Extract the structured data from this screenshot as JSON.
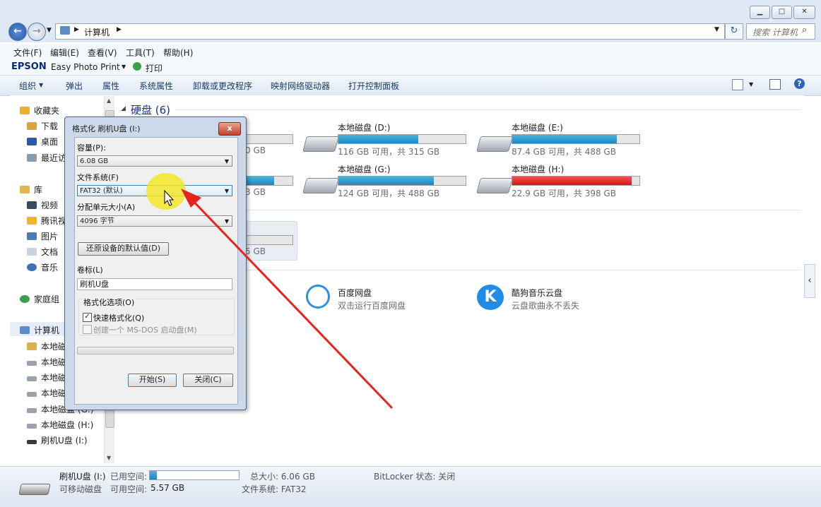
{
  "window": {
    "address": [
      "计算机"
    ],
    "search_placeholder": "搜索 计算机",
    "menu": [
      "文件(F)",
      "编辑(E)",
      "查看(V)",
      "工具(T)",
      "帮助(H)"
    ],
    "epson": {
      "brand": "EPSON",
      "app": "Easy Photo Print",
      "print": "打印"
    },
    "toolbar": [
      "组织",
      "弹出",
      "属性",
      "系统属性",
      "卸载或更改程序",
      "映射网络驱动器",
      "打开控制面板"
    ]
  },
  "nav": {
    "favorites": "收藏夹",
    "fav_items": [
      "下载",
      "桌面",
      "最近访"
    ],
    "libraries": "库",
    "lib_items": [
      "视频",
      "腾讯视",
      "图片",
      "文档",
      "音乐"
    ],
    "homegroup": "家庭组",
    "computer": "计算机",
    "drives": [
      "本地磁",
      "本地磁",
      "本地磁",
      "本地磁",
      "本地磁盘 (G:)",
      "本地磁盘 (H:)",
      "刷机U盘 (I:)"
    ]
  },
  "content": {
    "hdd_title": "硬盘 (6)",
    "drives": [
      {
        "name": "本地磁盘 (D:)",
        "info": "116 GB 可用，共 315 GB",
        "used": 0.63,
        "red": false
      },
      {
        "name": "本地磁盘 (E:)",
        "info": "87.4 GB 可用，共 488 GB",
        "used": 0.82,
        "red": false
      },
      {
        "name": "本地磁盘 (G:)",
        "info": "124 GB 可用，共 488 GB",
        "used": 0.75,
        "red": false
      },
      {
        "name": "本地磁盘 (H:)",
        "info": "22.9 GB 可用，共 398 GB",
        "used": 0.94,
        "red": true
      }
    ],
    "hidden_partial": [
      "0 GB",
      "3 GB",
      "5 GB"
    ],
    "apps": [
      {
        "name": "百度网盘",
        "desc": "双击运行百度网盘"
      },
      {
        "name": "酷狗音乐云盘",
        "desc": "云盘歌曲永不丢失"
      }
    ]
  },
  "status": {
    "name": "刷机U盘 (I:)",
    "type": "可移动磁盘",
    "used_label": "已用空间:",
    "free_label": "可用空间:",
    "free_value": "5.57 GB",
    "total": "总大小: 6.06 GB",
    "fs": "文件系统: FAT32",
    "bitlocker": "BitLocker 状态: 关闭",
    "used_fraction": 0.08
  },
  "dialog": {
    "title": "格式化 刷机U盘 (I:)",
    "close_glyph": "x",
    "capacity_label": "容量(P):",
    "capacity_value": "6.08 GB",
    "fs_label": "文件系统(F)",
    "fs_value": "FAT32 (默认)",
    "alloc_label": "分配单元大小(A)",
    "alloc_value": "4096 字节",
    "restore_button": "还原设备的默认值(D)",
    "volume_label": "卷标(L)",
    "volume_value": "刷机U盘",
    "options_label": "格式化选项(O)",
    "quick_format": "快速格式化(Q)",
    "msdos": "创建一个 MS-DOS 启动盘(M)",
    "start_button": "开始(S)",
    "close_button": "关闭(C)"
  }
}
